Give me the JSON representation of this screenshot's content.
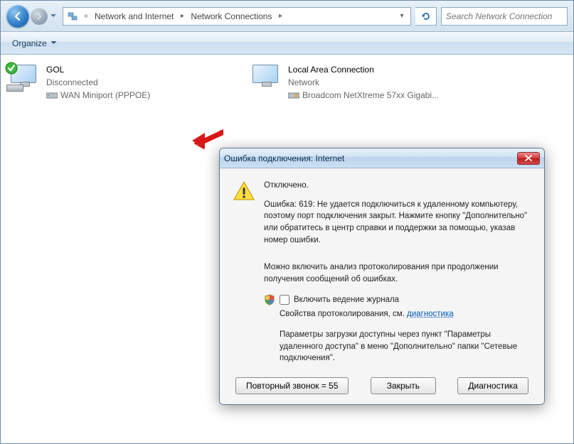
{
  "breadcrumb": {
    "seg1": "Network and Internet",
    "seg2": "Network Connections"
  },
  "search": {
    "placeholder": "Search Network Connection"
  },
  "toolbar": {
    "organize": "Organize"
  },
  "connections": [
    {
      "name": "GOL",
      "status": "Disconnected",
      "device": "WAN Miniport (PPPOE)",
      "status_icon": "disconnected"
    },
    {
      "name": "Local Area Connection",
      "status": "Network",
      "device": "Broadcom NetXtreme 57xx Gigabi...",
      "status_icon": "connected"
    }
  ],
  "dialog": {
    "title": "Ошибка подключения: Internet",
    "disconnected": "Отключено.",
    "error_msg": "Ошибка: 619: Не удается подключиться к удаленному компьютеру, поэтому порт подключения закрыт. Нажмите кнопку \"Дополнительно\" или обратитесь в центр справки и поддержки за помощью, указав номер ошибки.",
    "proto_msg": "Можно включить анализ протоколирования при продолжении получения сообщений об ошибках.",
    "enable_logging": "Включить ведение журнала",
    "proto_props": "Свойства протоколирования, см.",
    "diag_link": "диагностика",
    "boot_params": "Параметры загрузки доступны через пункт \"Параметры удаленного доступа\" в меню \"Дополнительно\" папки \"Сетевые подключения\".",
    "redial_btn": "Повторный звонок = 55",
    "close_btn": "Закрыть",
    "diag_btn": "Диагностика"
  }
}
